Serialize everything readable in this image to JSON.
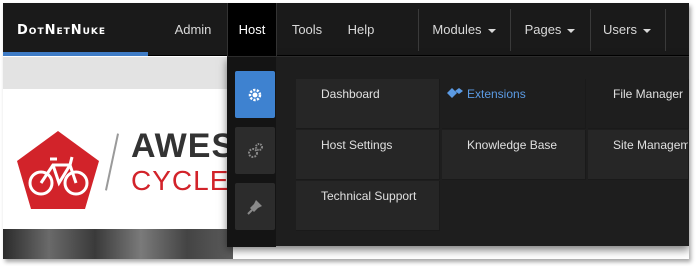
{
  "nav": {
    "logo": "DotNetNuke",
    "items": [
      {
        "label": "Admin"
      },
      {
        "label": "Host"
      },
      {
        "label": "Tools"
      },
      {
        "label": "Help"
      },
      {
        "label": "Modules"
      },
      {
        "label": "Pages"
      },
      {
        "label": "Users"
      }
    ]
  },
  "brand": {
    "line1": "AWES",
    "line2": "CYCLES"
  },
  "host_menu": {
    "items": [
      {
        "label": "Dashboard"
      },
      {
        "label": "Extensions"
      },
      {
        "label": "File Manager"
      },
      {
        "label": "Host Settings"
      },
      {
        "label": "Knowledge Base"
      },
      {
        "label": "Site Managem"
      },
      {
        "label": "Technical Support"
      }
    ]
  },
  "colors": {
    "accent": "#3e82d0",
    "brand_red": "#d2232a",
    "link_blue": "#5b9ae3"
  }
}
